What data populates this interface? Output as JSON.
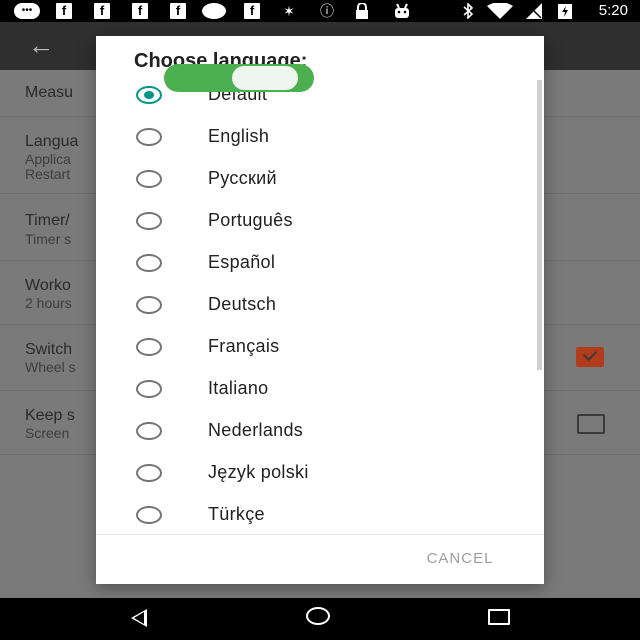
{
  "status_bar": {
    "time": "5:20",
    "icons": [
      "message-icon",
      "facebook-icon",
      "facebook-icon",
      "facebook-icon",
      "facebook-icon",
      "circle-icon",
      "facebook-icon",
      "satellite-icon",
      "info-icon",
      "lock-icon",
      "android-icon",
      "bluetooth-icon",
      "wifi-icon",
      "no-sim-icon",
      "battery-charging-icon"
    ],
    "fb_glyph": "f"
  },
  "app": {
    "back_icon": "←",
    "settings": [
      {
        "title": "Measu",
        "subtitle": ""
      },
      {
        "title": "Langua",
        "subtitle": "Applica",
        "subtitle2": "Restart"
      },
      {
        "title": "Timer/",
        "subtitle": "Timer s"
      },
      {
        "title": "Worko",
        "subtitle": "2 hours"
      },
      {
        "title": "Switch",
        "subtitle": "Wheel s",
        "checked": true
      },
      {
        "title": "Keep s",
        "subtitle": "Screen",
        "checked": false
      }
    ]
  },
  "dialog": {
    "title": "Choose language:",
    "options": [
      {
        "label": "Default",
        "selected": true
      },
      {
        "label": "English",
        "selected": false
      },
      {
        "label": "Русский",
        "selected": false
      },
      {
        "label": "Português",
        "selected": false
      },
      {
        "label": "Español",
        "selected": false
      },
      {
        "label": "Deutsch",
        "selected": false
      },
      {
        "label": "Français",
        "selected": false
      },
      {
        "label": "Italiano",
        "selected": false
      },
      {
        "label": "Nederlands",
        "selected": false
      },
      {
        "label": "Język polski",
        "selected": false
      },
      {
        "label": "Türkçe",
        "selected": false
      }
    ],
    "cancel_label": "CANCEL"
  },
  "colors": {
    "accent": "#009688",
    "toggle": "#4caf50",
    "checkbox_checked": "#b23b1c"
  }
}
